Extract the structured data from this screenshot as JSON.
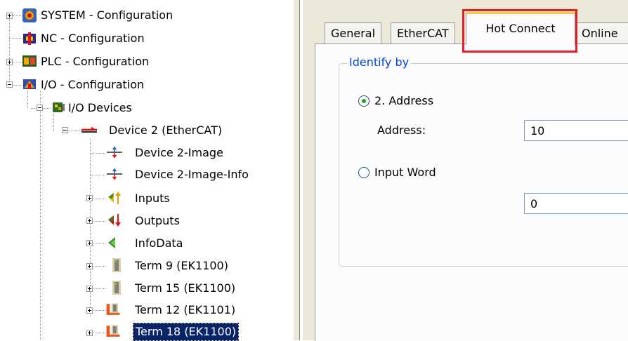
{
  "tree": {
    "system": "SYSTEM - Configuration",
    "nc": "NC - Configuration",
    "plc": "PLC - Configuration",
    "io": "I/O - Configuration",
    "io_devices": "I/O Devices",
    "device2": "Device 2 (EtherCAT)",
    "device2_image": "Device 2-Image",
    "device2_image_info": "Device 2-Image-Info",
    "inputs": "Inputs",
    "outputs": "Outputs",
    "infodata": "InfoData",
    "term9": "Term 9 (EK1100)",
    "term15": "Term 15 (EK1100)",
    "term12": "Term 12 (EK1101)",
    "term18": "Term 18 (EK1100)"
  },
  "tabs": {
    "general": "General",
    "ethercat": "EtherCAT",
    "hot_connect": "Hot Connect",
    "online": "Online"
  },
  "group": {
    "legend": "Identify by",
    "option_address": "2. Address",
    "address_label": "Address:",
    "address_value": "10",
    "option_input_word": "Input Word",
    "input_word_value": "0"
  },
  "colors": {
    "selection": "#0a246a",
    "highlight_box": "#e31e24",
    "legend_text": "#0046d5"
  }
}
